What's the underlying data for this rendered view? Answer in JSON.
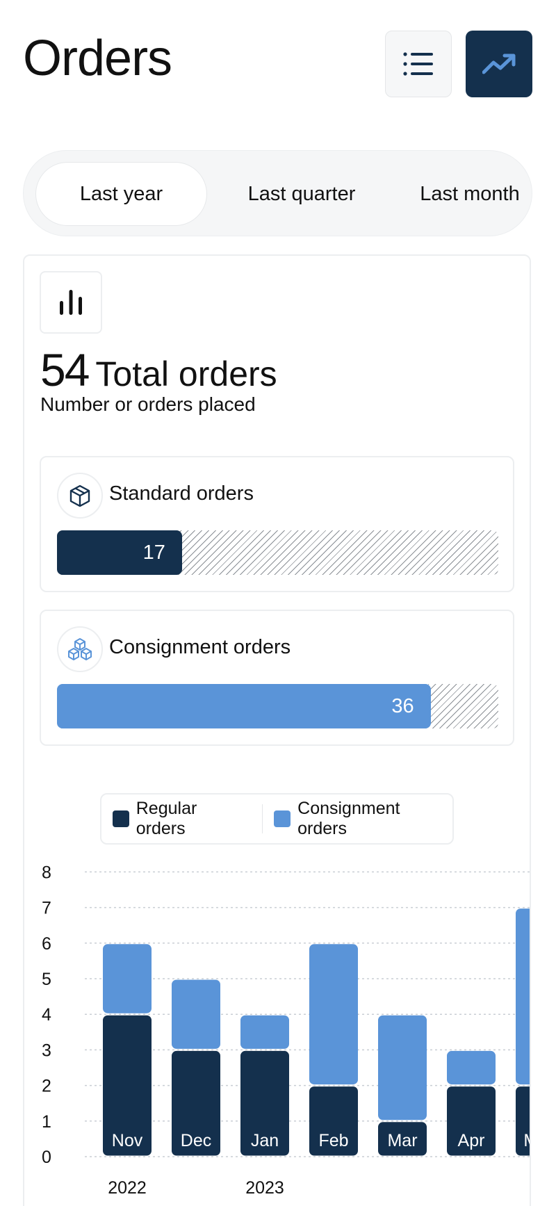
{
  "header": {
    "title": "Orders",
    "list_view_icon": "list-icon",
    "trend_view_icon": "trending-up-icon"
  },
  "period_tabs": [
    {
      "label": "Last year",
      "selected": true
    },
    {
      "label": "Last quarter",
      "selected": false
    },
    {
      "label": "Last month",
      "selected": false
    }
  ],
  "summary": {
    "icon": "bar-chart-icon",
    "total": "54",
    "total_label": "Total orders",
    "subtitle": "Number or orders placed"
  },
  "breakdown": [
    {
      "label": "Standard orders",
      "icon": "package-icon",
      "value": "17",
      "fraction": 0.2833,
      "color": "#14304d"
    },
    {
      "label": "Consignment orders",
      "icon": "cubes-icon",
      "value": "36",
      "fraction": 0.8466,
      "color": "#5a94d8"
    }
  ],
  "colors": {
    "brand_dark": "#14304d",
    "brand_light": "#5a94d8"
  },
  "chart_data": {
    "type": "bar",
    "stacked": true,
    "legend": [
      "Regular orders",
      "Consignment orders"
    ],
    "categories": [
      "Nov",
      "Dec",
      "Jan",
      "Feb",
      "Mar",
      "Apr",
      "May"
    ],
    "series": [
      {
        "name": "Regular orders",
        "values": [
          4,
          3,
          3,
          2,
          1,
          2,
          2
        ],
        "color": "#14304d"
      },
      {
        "name": "Consignment orders",
        "values": [
          2,
          2,
          1,
          4,
          3,
          1,
          5
        ],
        "color": "#5a94d8"
      }
    ],
    "ylim": [
      0,
      8
    ],
    "yticks": [
      "0",
      "1",
      "2",
      "3",
      "4",
      "5",
      "6",
      "7",
      "8"
    ],
    "year_labels": [
      {
        "label": "2022",
        "category": "Nov"
      },
      {
        "label": "2023",
        "category": "Jan"
      }
    ],
    "grid": true
  }
}
